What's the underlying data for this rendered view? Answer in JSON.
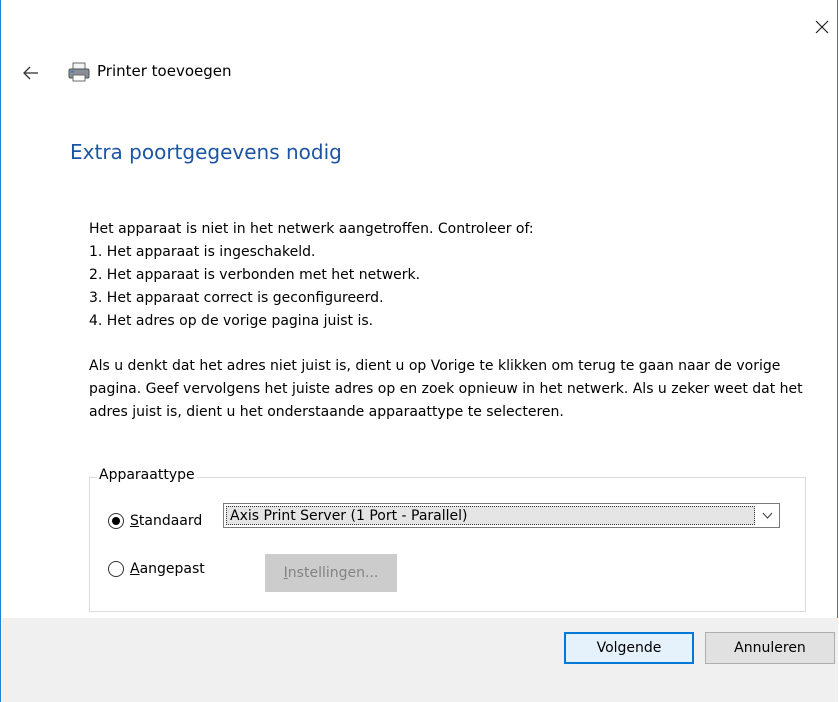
{
  "window": {
    "title": "Printer toevoegen"
  },
  "page": {
    "heading": "Extra poortgegevens nodig",
    "intro": "Het apparaat is niet in het netwerk aangetroffen. Controleer of:",
    "checks": [
      "1. Het apparaat is ingeschakeld.",
      "2. Het apparaat is verbonden met het netwerk.",
      "3. Het apparaat correct is geconfigureerd.",
      "4. Het adres op de vorige pagina juist is."
    ],
    "advice": "Als u denkt dat het adres niet juist is, dient u op Vorige te klikken om terug te gaan naar de vorige pagina. Geef vervolgens het juiste adres op en zoek opnieuw in het netwerk. Als u zeker weet dat het adres juist is, dient u het onderstaande apparaattype te selecteren."
  },
  "device_type": {
    "legend": "Apparaattype",
    "standard_label": "Standaard",
    "standard_checked": true,
    "standard_selected_value": "Axis Print Server (1 Port - Parallel)",
    "custom_label": "Aangepast",
    "custom_checked": false,
    "settings_button_label": "Instellingen..."
  },
  "footer": {
    "next_label": "Volgende",
    "cancel_label": "Annuleren"
  },
  "icons": {
    "close": "close-icon",
    "back": "back-arrow-icon",
    "printer": "printer-icon",
    "dropdown": "chevron-down-icon"
  },
  "colors": {
    "heading": "#1d55a4",
    "accent": "#0078d7",
    "border": "#1883d7"
  }
}
